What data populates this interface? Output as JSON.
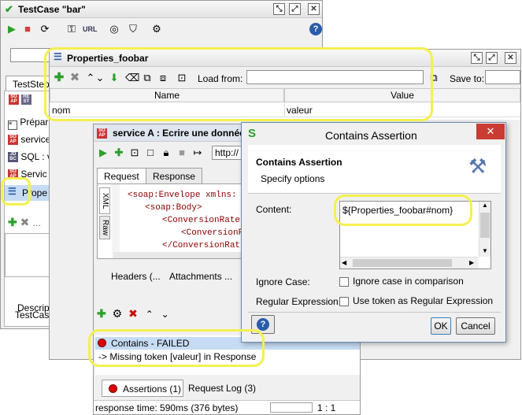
{
  "main_window": {
    "title": "TestCase \"bar\"",
    "tab_label": "TestSteps",
    "steps": [
      "Prépar",
      "service",
      "SQL : v",
      "Servic",
      "Prope"
    ],
    "description_tab": "Descript",
    "testcase_tab": "TestCase",
    "url_label": "URL"
  },
  "properties_window": {
    "title": "Properties_foobar",
    "load_from_label": "Load from:",
    "save_to_label": "Save to:",
    "table_headers": [
      "Name",
      "Value"
    ],
    "rows": [
      {
        "name": "nom",
        "value": "valeur"
      }
    ]
  },
  "service_window": {
    "title": "service A : Ecrire une donnée",
    "endpoint": "http://",
    "tabs": [
      "Request",
      "Response"
    ],
    "side_tabs": [
      "XML",
      "Raw"
    ],
    "xml_lines": [
      "<soap:Envelope xmlns:",
      "<soap:Body>",
      "<ConversionRate",
      "<ConversionR",
      "</ConversionRat"
    ],
    "bottom_tabs": [
      "Headers (...",
      "Attachments ..."
    ],
    "assertion_status": "Contains - FAILED",
    "assertion_message": "-> Missing token [valeur] in Response",
    "assertions_tab": "Assertions (1)",
    "request_log_tab": "Request Log (3)",
    "response_time": "response time: 590ms (376 bytes)",
    "cursor_pos": "1 : 1"
  },
  "dialog": {
    "title": "Contains Assertion",
    "heading": "Contains Assertion",
    "subheading": "Specify options",
    "content_label": "Content:",
    "content_value": "${Properties_foobar#nom}",
    "ignore_case_label": "Ignore Case:",
    "ignore_case_text": "Ignore case in comparison",
    "regex_label": "Regular Expression:",
    "regex_text": "Use token as Regular Expression",
    "ok_label": "OK",
    "cancel_label": "Cancel",
    "close_glyph": "✕",
    "help_glyph": "?"
  },
  "colors": {
    "highlight": "#f4f050",
    "selection": "#c6dcf4",
    "dialog_close": "#c83c34",
    "play": "#2aa02a"
  }
}
